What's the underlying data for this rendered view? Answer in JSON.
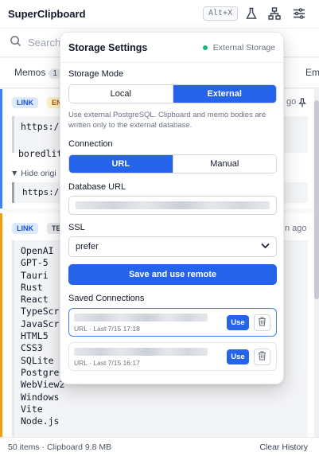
{
  "app": {
    "title": "SuperClipboard",
    "shortcut": "Alt+X",
    "icons": [
      "flask-icon",
      "network-icon",
      "sliders-icon"
    ]
  },
  "search": {
    "placeholder": "Search"
  },
  "tabs": [
    {
      "label": "Memos",
      "count": "1"
    },
    {
      "label": "Em"
    }
  ],
  "list": {
    "items": [
      {
        "chips": [
          "LINK",
          "EN"
        ],
        "age": "go",
        "lines": [
          "https://",
          "boredlit"
        ],
        "toggle": "▼ Hide origi",
        "original": "https://"
      },
      {
        "chips": [
          "LINK",
          "TE"
        ],
        "age": "n ago",
        "lines": [
          "OpenAI C",
          "GPT-5",
          "Tauri",
          "Rust",
          "React",
          "TypeScri",
          "JavaScri",
          "HTML5",
          "CSS3",
          "SQLite",
          "PostgreS",
          "WebView2",
          "Windows",
          "Vite",
          "Node.js"
        ]
      }
    ]
  },
  "footer": {
    "summary": "50 items · Clipboard 9.8 MB",
    "clear": "Clear History"
  },
  "storage": {
    "title": "Storage Settings",
    "status": "External Storage",
    "status_color": "#10b981",
    "accent": "#2563eb",
    "mode_label": "Storage Mode",
    "mode_options": [
      "Local",
      "External"
    ],
    "mode_selected": "External",
    "help": "Use external PostgreSQL. Clipboard and memo bodies are written only to the external database.",
    "connection_label": "Connection",
    "connection_options": [
      "URL",
      "Manual"
    ],
    "connection_selected": "URL",
    "db_url_label": "Database URL",
    "ssl_label": "SSL",
    "ssl_value": "prefer",
    "save_button": "Save and use remote",
    "saved_label": "Saved Connections",
    "saved": [
      {
        "meta": "URL · Last 7/15 17:18",
        "use": "Use",
        "selected": true
      },
      {
        "meta": "URL · Last 7/15 16:17",
        "use": "Use",
        "selected": false
      }
    ]
  }
}
